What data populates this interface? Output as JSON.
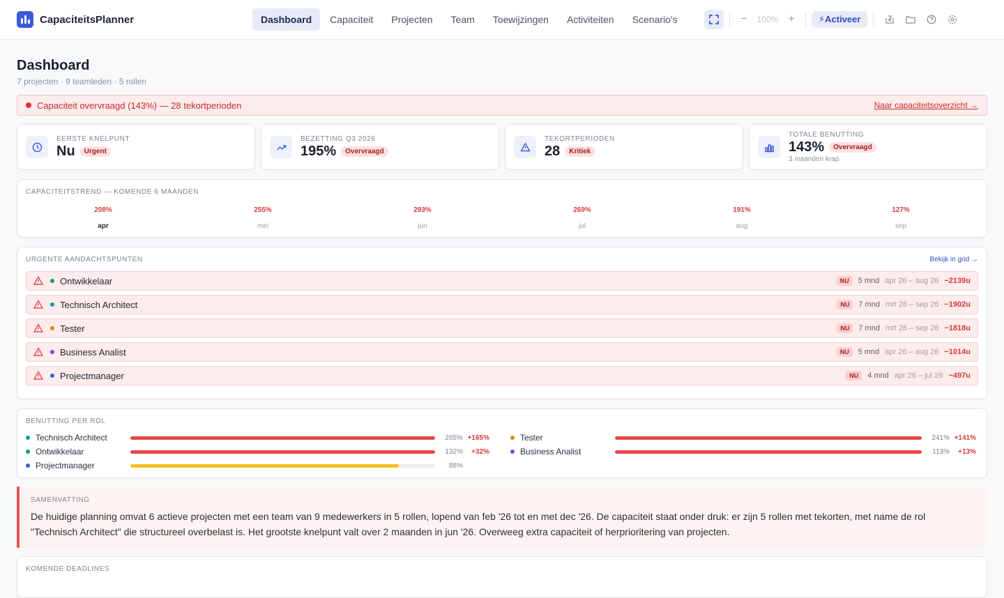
{
  "app": {
    "name": "CapaciteitsPlanner"
  },
  "nav": {
    "items": [
      {
        "label": "Dashboard",
        "active": true
      },
      {
        "label": "Capaciteit",
        "active": false
      },
      {
        "label": "Projecten",
        "active": false
      },
      {
        "label": "Team",
        "active": false
      },
      {
        "label": "Toewijzingen",
        "active": false
      },
      {
        "label": "Activiteiten",
        "active": false
      },
      {
        "label": "Scenario's",
        "active": false
      }
    ]
  },
  "toolbar": {
    "zoom_minus": "−",
    "zoom_value": "100%",
    "zoom_plus": "+",
    "activate_label": "⚡Activeer",
    "icons": [
      "download-icon",
      "folder-icon",
      "help-icon",
      "settings-icon"
    ]
  },
  "header": {
    "title": "Dashboard",
    "subtitle": "7 projecten · 9 teamleden · 5 rollen"
  },
  "alert": {
    "text": "Capaciteit overvraagd (143%) — 28 tekortperioden",
    "link": "Naar capaciteitsoverzicht →"
  },
  "kpis": [
    {
      "label": "Eerste knelpunt",
      "value": "Nu",
      "badge": "Urgent",
      "note": "",
      "icon": "clock-icon"
    },
    {
      "label": "Bezetting Q3 2026",
      "value": "195%",
      "badge": "Overvraagd",
      "note": "",
      "icon": "trending-up-icon"
    },
    {
      "label": "Tekortperioden",
      "value": "28",
      "badge": "Kritiek",
      "note": "",
      "icon": "warning-icon"
    },
    {
      "label": "Totale benutting",
      "value": "143%",
      "badge": "Overvraagd",
      "note": "3 maanden krap",
      "icon": "bar-chart-icon"
    }
  ],
  "trend": {
    "title": "Capaciteitstrend — komende 6 maanden",
    "months": [
      {
        "month": "apr",
        "pct": "208%",
        "current": true
      },
      {
        "month": "mei",
        "pct": "255%",
        "current": false
      },
      {
        "month": "jun",
        "pct": "293%",
        "current": false
      },
      {
        "month": "jul",
        "pct": "269%",
        "current": false
      },
      {
        "month": "aug",
        "pct": "191%",
        "current": false
      },
      {
        "month": "sep",
        "pct": "127%",
        "current": false
      }
    ]
  },
  "urgent": {
    "title": "Urgente aandachtspunten",
    "link": "Bekijk in grid →",
    "items": [
      {
        "role": "Ontwikkelaar",
        "color": "#12a150",
        "badge": "NU",
        "duration": "5 mnd",
        "range": "apr 26 – aug 26",
        "deficit": "−2139u"
      },
      {
        "role": "Technisch Architect",
        "color": "#0f9ba8",
        "badge": "NU",
        "duration": "7 mnd",
        "range": "mrt 26 – sep 26",
        "deficit": "−1902u"
      },
      {
        "role": "Tester",
        "color": "#d98a0b",
        "badge": "NU",
        "duration": "7 mnd",
        "range": "mrt 26 – sep 26",
        "deficit": "−1818u"
      },
      {
        "role": "Business Analist",
        "color": "#8b3fd9",
        "badge": "NU",
        "duration": "5 mnd",
        "range": "apr 26 – aug 26",
        "deficit": "−1014u"
      },
      {
        "role": "Projectmanager",
        "color": "#3b5bdb",
        "badge": "NU",
        "duration": "4 mnd",
        "range": "apr 26 – jul 26",
        "deficit": "−497u"
      }
    ]
  },
  "utilization": {
    "title": "Benutting per rol",
    "roles": [
      {
        "role": "Technisch Architect",
        "color": "#0f9ba8",
        "pct": "265%",
        "excess": "+165%",
        "fill": 1.0,
        "bar": "#e84545"
      },
      {
        "role": "Tester",
        "color": "#d98a0b",
        "pct": "241%",
        "excess": "+141%",
        "fill": 1.0,
        "bar": "#e84545"
      },
      {
        "role": "Ontwikkelaar",
        "color": "#12a150",
        "pct": "132%",
        "excess": "+32%",
        "fill": 1.0,
        "bar": "#e84545"
      },
      {
        "role": "Business Analist",
        "color": "#8b3fd9",
        "pct": "113%",
        "excess": "+13%",
        "fill": 1.0,
        "bar": "#e84545"
      },
      {
        "role": "Projectmanager",
        "color": "#3b5bdb",
        "pct": "88%",
        "excess": "",
        "fill": 0.88,
        "bar": "#f5bf26"
      }
    ]
  },
  "summary": {
    "title": "Samenvatting",
    "text": "De huidige planning omvat 6 actieve projecten met een team van 9 medewerkers in 5 rollen, lopend van feb '26 tot en met dec '26. De capaciteit staat onder druk: er zijn 5 rollen met tekorten, met name de rol \"Technisch Architect\" die structureel overbelast is. Het grootste knelpunt valt over 2 maanden in jun '26. Overweeg extra capaciteit of herprioritering van projecten."
  },
  "deadlines": {
    "title": "Komende deadlines"
  }
}
